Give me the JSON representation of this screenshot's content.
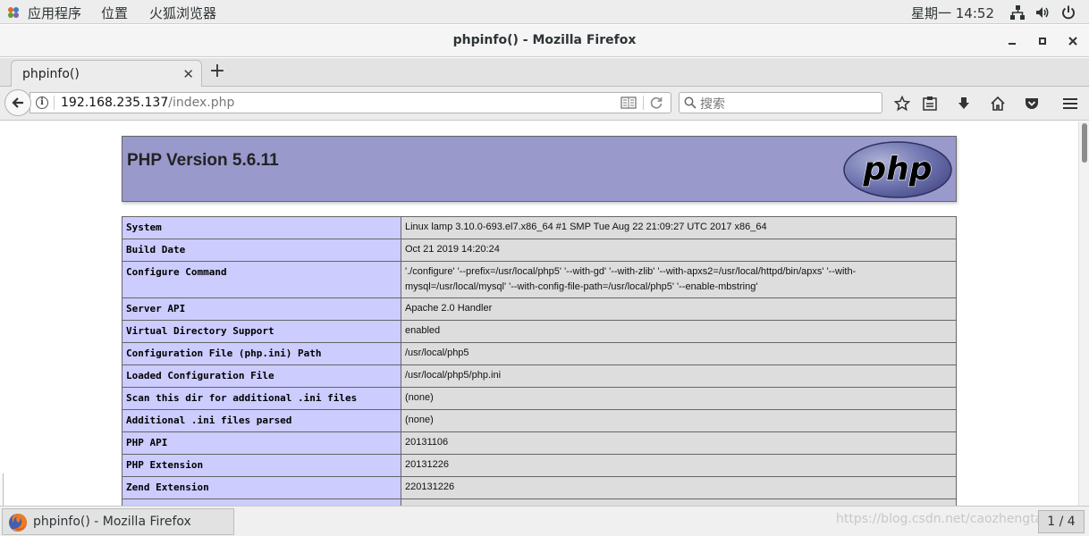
{
  "topbar": {
    "apps_label": "应用程序",
    "places_label": "位置",
    "firefox_label": "火狐浏览器",
    "clock": "星期一 14:52"
  },
  "window": {
    "title": "phpinfo() - Mozilla Firefox"
  },
  "tabs": [
    {
      "label": "phpinfo()",
      "active": true
    }
  ],
  "navbar": {
    "url_host": "192.168.235.137",
    "url_path": "/index.php",
    "search_placeholder": "搜索"
  },
  "php": {
    "header_title": "PHP Version 5.6.11",
    "rows": [
      {
        "key": "System",
        "value": "Linux lamp 3.10.0-693.el7.x86_64 #1 SMP Tue Aug 22 21:09:27 UTC 2017 x86_64"
      },
      {
        "key": "Build Date",
        "value": "Oct 21 2019 14:20:24"
      },
      {
        "key": "Configure Command",
        "value": "'./configure' '--prefix=/usr/local/php5' '--with-gd' '--with-zlib' '--with-apxs2=/usr/local/httpd/bin/apxs' '--with-mysql=/usr/local/mysql' '--with-config-file-path=/usr/local/php5' '--enable-mbstring'"
      },
      {
        "key": "Server API",
        "value": "Apache 2.0 Handler"
      },
      {
        "key": "Virtual Directory Support",
        "value": "enabled"
      },
      {
        "key": "Configuration File (php.ini) Path",
        "value": "/usr/local/php5"
      },
      {
        "key": "Loaded Configuration File",
        "value": "/usr/local/php5/php.ini"
      },
      {
        "key": "Scan this dir for additional .ini files",
        "value": "(none)"
      },
      {
        "key": "Additional .ini files parsed",
        "value": "(none)"
      },
      {
        "key": "PHP API",
        "value": "20131106"
      },
      {
        "key": "PHP Extension",
        "value": "20131226"
      },
      {
        "key": "Zend Extension",
        "value": "220131226"
      },
      {
        "key": "",
        "value": ""
      }
    ]
  },
  "taskbar": {
    "item_label": "phpinfo() - Mozilla Firefox",
    "watermark": "https://blog.csdn.net/caozhengtao1994",
    "workspace": "1 / 4"
  },
  "colors": {
    "php_header": "#9999cc",
    "key_cell": "#ccccff",
    "value_cell": "#dddddd"
  }
}
